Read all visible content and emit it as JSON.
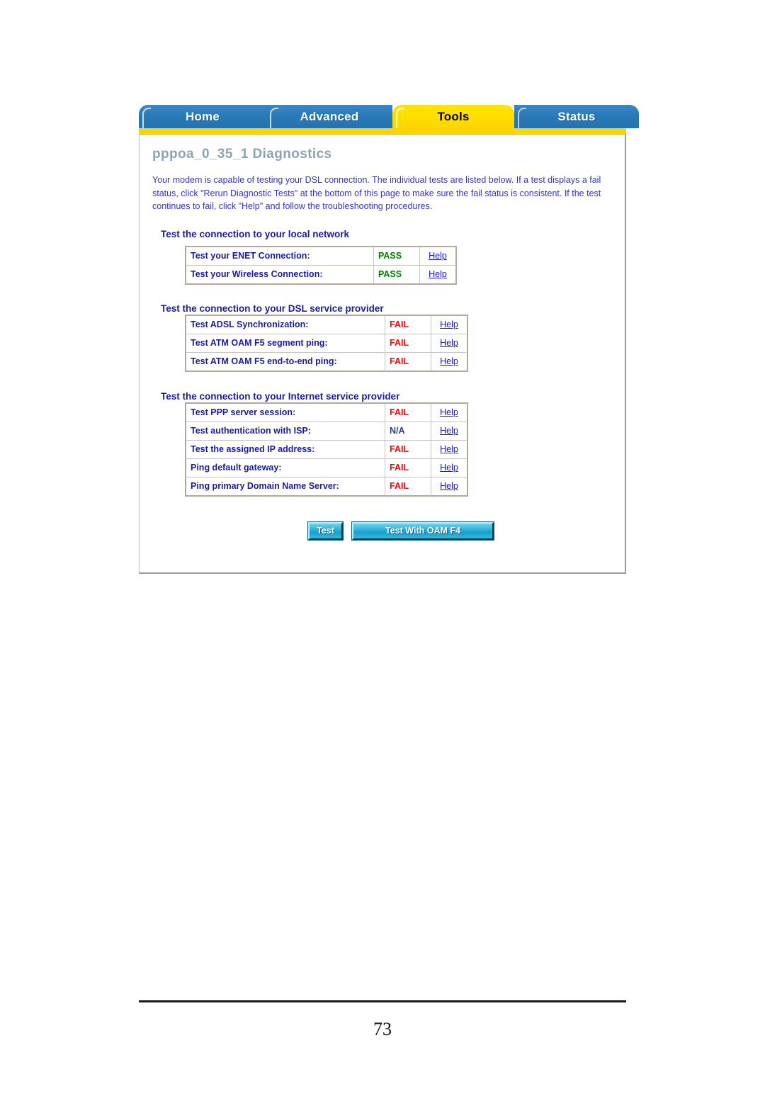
{
  "nav": {
    "tabs": [
      {
        "label": "Home",
        "active": false
      },
      {
        "label": "Advanced",
        "active": false
      },
      {
        "label": "Tools",
        "active": true
      },
      {
        "label": "Status",
        "active": false
      }
    ]
  },
  "page": {
    "title": "pppoa_0_35_1 Diagnostics",
    "intro": "Your modem is capable of testing your DSL connection. The individual tests are listed below. If a test displays a fail status, click \"Rerun Diagnostic Tests\" at the bottom of this page to make sure the fail status is consistent. If the test continues to fail, click \"Help\" and follow the troubleshooting procedures."
  },
  "sections": [
    {
      "heading": "Test the connection to your local network",
      "rows": [
        {
          "label": "Test your ENET Connection:",
          "status": "PASS",
          "status_kind": "pass",
          "help": "Help"
        },
        {
          "label": "Test your Wireless Connection:",
          "status": "PASS",
          "status_kind": "pass",
          "help": "Help"
        }
      ]
    },
    {
      "heading": "Test the connection to your DSL service provider",
      "rows": [
        {
          "label": "Test ADSL Synchronization:",
          "status": "FAIL",
          "status_kind": "fail",
          "help": "Help"
        },
        {
          "label": "Test ATM OAM F5 segment ping:",
          "status": "FAIL",
          "status_kind": "fail",
          "help": "Help"
        },
        {
          "label": "Test ATM OAM F5 end-to-end ping:",
          "status": "FAIL",
          "status_kind": "fail",
          "help": "Help"
        }
      ]
    },
    {
      "heading": "Test the connection to your Internet service provider",
      "rows": [
        {
          "label": "Test PPP server session:",
          "status": "FAIL",
          "status_kind": "fail",
          "help": "Help"
        },
        {
          "label": "Test authentication with ISP:",
          "status": "N/A",
          "status_kind": "na",
          "help": "Help"
        },
        {
          "label": "Test the assigned IP address:",
          "status": "FAIL",
          "status_kind": "fail",
          "help": "Help"
        },
        {
          "label": "Ping default gateway:",
          "status": "FAIL",
          "status_kind": "fail",
          "help": "Help"
        },
        {
          "label": "Ping primary Domain Name Server:",
          "status": "FAIL",
          "status_kind": "fail",
          "help": "Help"
        }
      ]
    }
  ],
  "buttons": {
    "test": "Test",
    "test_with_oam_f4": "Test With OAM F4"
  },
  "footer": {
    "page_number": "73"
  },
  "colors": {
    "tab_active_bg": "#ffd400",
    "tab_inactive_bg": "#2a7ab8",
    "pass": "#008000",
    "fail": "#ff0000",
    "na": "#2b3b8f",
    "link": "#1414e0",
    "heading": "#1a1aa8",
    "page_title": "#8fa3ae",
    "button": "#33b4dd"
  }
}
